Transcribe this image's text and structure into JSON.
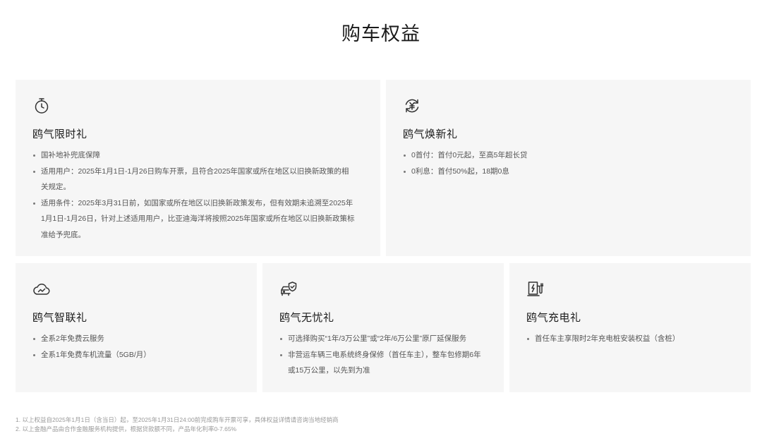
{
  "page": {
    "title": "购车权益"
  },
  "cards": [
    {
      "icon": "stopwatch-icon",
      "title": "鸥气限时礼",
      "items": [
        "国补地补兜底保障",
        "适用用户：2025年1月1日-1月26日购车开票，且符合2025年国家或所在地区以旧换新政策的相关规定。",
        "适用条件：2025年3月31日前，如国家或所在地区以旧换新政策发布，但有效期未追溯至2025年1月1日-1月26日，针对上述适用用户，比亚迪海洋将按照2025年国家或所在地区以旧换新政策标准给予兜底。"
      ]
    },
    {
      "icon": "yuan-exchange-icon",
      "title": "鸥气焕新礼",
      "items": [
        "0首付：首付0元起，至高5年超长贷",
        "0利息：首付50%起，18期0息"
      ]
    },
    {
      "icon": "cloud-connect-icon",
      "title": "鸥气智联礼",
      "items": [
        "全系2年免费云服务",
        "全系1年免费车机流量（5GB/月）"
      ]
    },
    {
      "icon": "car-shield-icon",
      "title": "鸥气无忧礼",
      "items": [
        "可选择购买“1年/3万公里”或“2年/6万公里”原厂延保服务",
        "非营运车辆三电系统终身保修（首任车主），整车包修期6年或15万公里，以先到为准"
      ]
    },
    {
      "icon": "charging-pile-icon",
      "title": "鸥气充电礼",
      "items": [
        "首任车主享限时2年充电桩安装权益（含桩）"
      ]
    }
  ],
  "footnotes": [
    "1. 以上权益自2025年1月1日（含当日）起，至2025年1月31日24:00前完成购车开票可享，具体权益详情请咨询当地经销商",
    "2. 以上金融产品由合作金融服务机构提供，根据贷款额不同，产品年化利率0-7.65%"
  ]
}
